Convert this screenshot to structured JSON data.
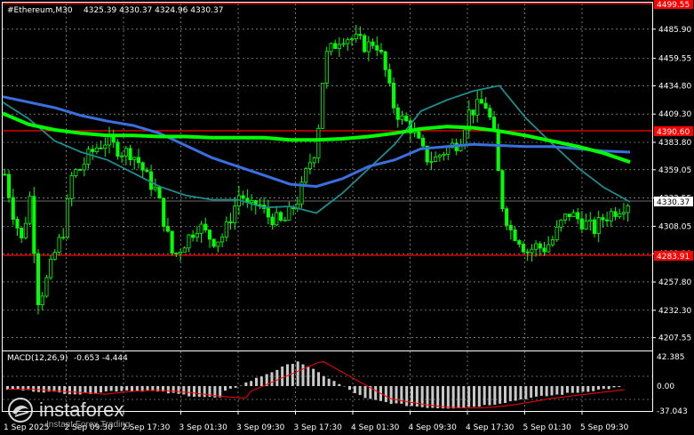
{
  "header": {
    "symbol": "#Ethereum,M30",
    "ohlc": "4325.39 4330.37 4324.96 4330.37"
  },
  "price_axis": {
    "ticks": [
      "4485.90",
      "4459.55",
      "4434.80",
      "4409.30",
      "4383.80",
      "4359.05",
      "4333.55",
      "4308.05",
      "4283.30",
      "4257.80",
      "4232.30",
      "4207.55"
    ]
  },
  "levels": [
    {
      "name": "resistance",
      "value": "4499.55",
      "color": "#ff0000"
    },
    {
      "name": "pivot",
      "value": "4390.60",
      "color": "#ff0000"
    },
    {
      "name": "support",
      "value": "4283.91",
      "color": "#ff0000"
    }
  ],
  "current_price": {
    "value": "4330.37"
  },
  "time_axis": {
    "ticks": [
      "1 Sep 2025",
      "2 Sep 09:30",
      "2 Sep 17:30",
      "3 Sep 01:30",
      "3 Sep 09:30",
      "3 Sep 17:30",
      "4 Sep 01:30",
      "4 Sep 09:30",
      "4 Sep 17:30",
      "5 Sep 01:30",
      "5 Sep 09:30"
    ]
  },
  "macd": {
    "label": "MACD(12,26,9)",
    "values": "-0.653 -4.444",
    "axis_ticks": [
      "42.385",
      "0.00",
      "-37.043"
    ]
  },
  "watermark": {
    "name": "instaforex",
    "sub": "Instant Forex Trading"
  },
  "colors": {
    "background": "#000000",
    "grid": "#ffffff",
    "candle": "#00ff00",
    "ma_slow": "#00ff00",
    "ma_mid": "#3a6fe0",
    "ma_fast": "#1e8c8c",
    "level": "#ff0000",
    "macd_hist": "#c8c8c8",
    "macd_signal": "#ff0000"
  },
  "chart_data": {
    "type": "candlestick",
    "title": "#Ethereum,M30",
    "ylim": [
      4200,
      4505
    ],
    "close_path": [
      4355,
      4320,
      4295,
      4335,
      4240,
      4260,
      4285,
      4305,
      4355,
      4360,
      4372,
      4380,
      4385,
      4380,
      4375,
      4375,
      4365,
      4350,
      4340,
      4310,
      4280,
      4290,
      4300,
      4310,
      4300,
      4295,
      4300,
      4320,
      4340,
      4322,
      4330,
      4318,
      4315,
      4310,
      4322,
      4335,
      4362,
      4380,
      4460,
      4470,
      4480,
      4478,
      4475,
      4470,
      4476,
      4455,
      4420,
      4405,
      4400,
      4385,
      4370,
      4368,
      4375,
      4380,
      4385,
      4410,
      4415,
      4420,
      4395,
      4330,
      4305,
      4298,
      4285,
      4290,
      4288,
      4295,
      4310,
      4320,
      4315,
      4310,
      4305,
      4315,
      4320,
      4325,
      4330
    ],
    "ma_slow": [
      4410,
      4400,
      4395,
      4392,
      4390,
      4390,
      4389,
      4389,
      4388,
      4388,
      4388,
      4386,
      4386,
      4387,
      4389,
      4392,
      4396,
      4398,
      4397,
      4394,
      4390,
      4385,
      4380,
      4374,
      4366
    ],
    "ma_mid": [
      4425,
      4420,
      4415,
      4408,
      4403,
      4399,
      4392,
      4381,
      4370,
      4362,
      4354,
      4346,
      4344,
      4351,
      4362,
      4368,
      4378,
      4380,
      4382,
      4381,
      4380,
      4380,
      4378,
      4376,
      4375
    ],
    "ma_fast": [
      4420,
      4405,
      4385,
      4375,
      4368,
      4356,
      4344,
      4336,
      4332,
      4332,
      4325,
      4326,
      4320,
      4338,
      4360,
      4382,
      4412,
      4422,
      4430,
      4435,
      4406,
      4383,
      4361,
      4343,
      4330
    ],
    "macd_histogram_shape": "negative through 3 Sep 09:30, positive peak near 3 Sep 17:30, negative trough near 4 Sep 17:30, last value -0.653",
    "macd_signal_last": -4.444
  }
}
